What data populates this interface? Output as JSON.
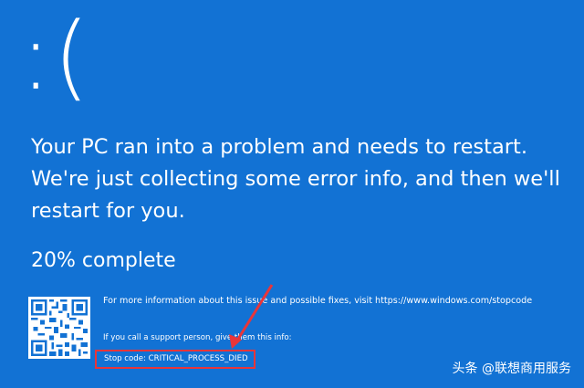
{
  "bsod": {
    "frown": ":(",
    "message": "Your PC ran into a problem and needs to restart. We're just collecting some error info, and then we'll restart for you.",
    "progress": "20% complete",
    "more_info": "For more information about this issue and possible fixes, visit https://www.windows.com/stopcode",
    "support": "If you call a support person, give them this info:",
    "stop_code": "Stop code: CRITICAL_PROCESS_DIED",
    "progress_percent": 20
  },
  "annotation": {
    "highlight_color": "#e8353a"
  },
  "watermark": {
    "text": "头条 @联想商用服务"
  },
  "colors": {
    "background": "#1272d4",
    "foreground": "#ffffff"
  },
  "icons": [
    "qr-code-icon",
    "arrow-icon"
  ]
}
